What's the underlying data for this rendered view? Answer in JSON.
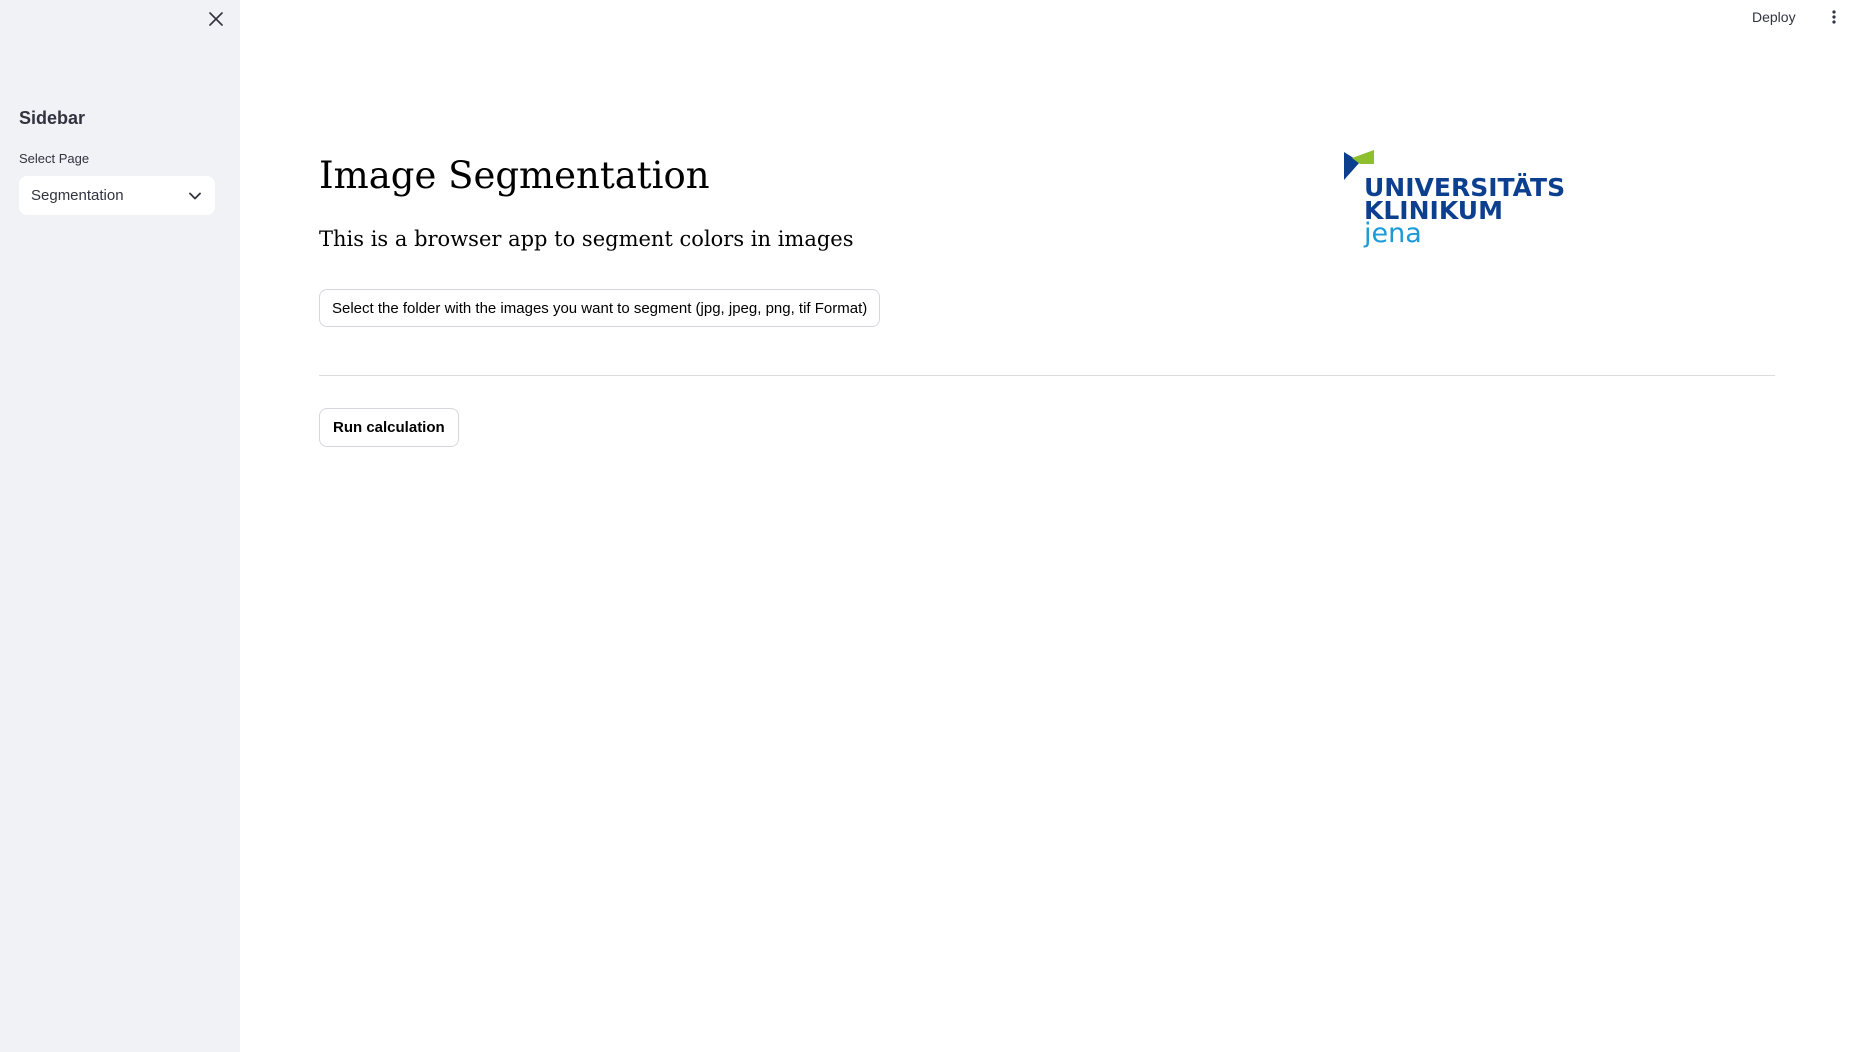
{
  "sidebar": {
    "title": "Sidebar",
    "select_label": "Select Page",
    "select_value": "Segmentation",
    "close_icon": "close-icon",
    "chevron_icon": "chevron-down-icon"
  },
  "header": {
    "deploy_label": "Deploy",
    "menu_icon": "kebab-menu-icon"
  },
  "main": {
    "title": "Image Segmentation",
    "subtitle": "This is a browser app to segment colors in images",
    "folder_button_label": "Select the folder with the images you want to segment (jpg, jpeg, png, tif Format)",
    "run_button_label": "Run calculation"
  },
  "logo": {
    "line1": "UNIVERSITÄTS",
    "line2": "KLINIKUM",
    "line3": "jena"
  },
  "colors": {
    "sidebar_bg": "#f0f2f6",
    "logo_dark_blue": "#0d3f8f",
    "logo_light_blue": "#1b9ad6",
    "logo_green": "#8dbf2f",
    "text": "#31333f"
  }
}
